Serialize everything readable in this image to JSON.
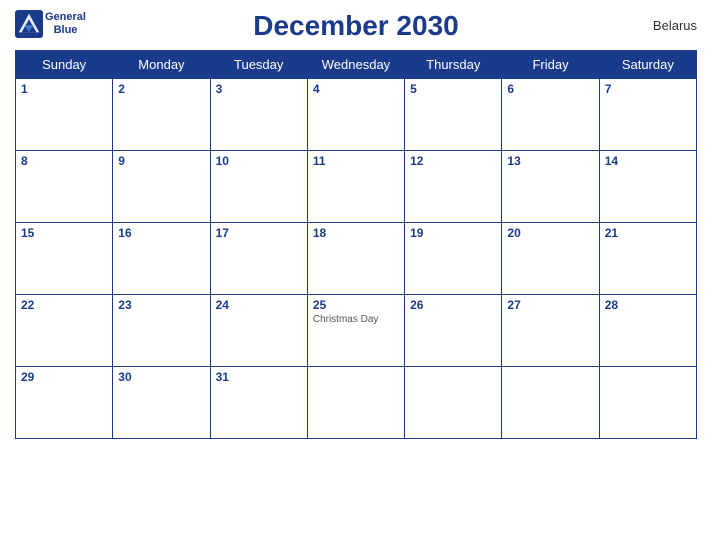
{
  "header": {
    "title": "December 2030",
    "country": "Belarus",
    "logo": {
      "line1": "General",
      "line2": "Blue"
    }
  },
  "weekdays": [
    "Sunday",
    "Monday",
    "Tuesday",
    "Wednesday",
    "Thursday",
    "Friday",
    "Saturday"
  ],
  "weeks": [
    [
      {
        "day": "1",
        "holiday": ""
      },
      {
        "day": "2",
        "holiday": ""
      },
      {
        "day": "3",
        "holiday": ""
      },
      {
        "day": "4",
        "holiday": ""
      },
      {
        "day": "5",
        "holiday": ""
      },
      {
        "day": "6",
        "holiday": ""
      },
      {
        "day": "7",
        "holiday": ""
      }
    ],
    [
      {
        "day": "8",
        "holiday": ""
      },
      {
        "day": "9",
        "holiday": ""
      },
      {
        "day": "10",
        "holiday": ""
      },
      {
        "day": "11",
        "holiday": ""
      },
      {
        "day": "12",
        "holiday": ""
      },
      {
        "day": "13",
        "holiday": ""
      },
      {
        "day": "14",
        "holiday": ""
      }
    ],
    [
      {
        "day": "15",
        "holiday": ""
      },
      {
        "day": "16",
        "holiday": ""
      },
      {
        "day": "17",
        "holiday": ""
      },
      {
        "day": "18",
        "holiday": ""
      },
      {
        "day": "19",
        "holiday": ""
      },
      {
        "day": "20",
        "holiday": ""
      },
      {
        "day": "21",
        "holiday": ""
      }
    ],
    [
      {
        "day": "22",
        "holiday": ""
      },
      {
        "day": "23",
        "holiday": ""
      },
      {
        "day": "24",
        "holiday": ""
      },
      {
        "day": "25",
        "holiday": "Christmas Day"
      },
      {
        "day": "26",
        "holiday": ""
      },
      {
        "day": "27",
        "holiday": ""
      },
      {
        "day": "28",
        "holiday": ""
      }
    ],
    [
      {
        "day": "29",
        "holiday": ""
      },
      {
        "day": "30",
        "holiday": ""
      },
      {
        "day": "31",
        "holiday": ""
      },
      {
        "day": "",
        "holiday": ""
      },
      {
        "day": "",
        "holiday": ""
      },
      {
        "day": "",
        "holiday": ""
      },
      {
        "day": "",
        "holiday": ""
      }
    ]
  ]
}
